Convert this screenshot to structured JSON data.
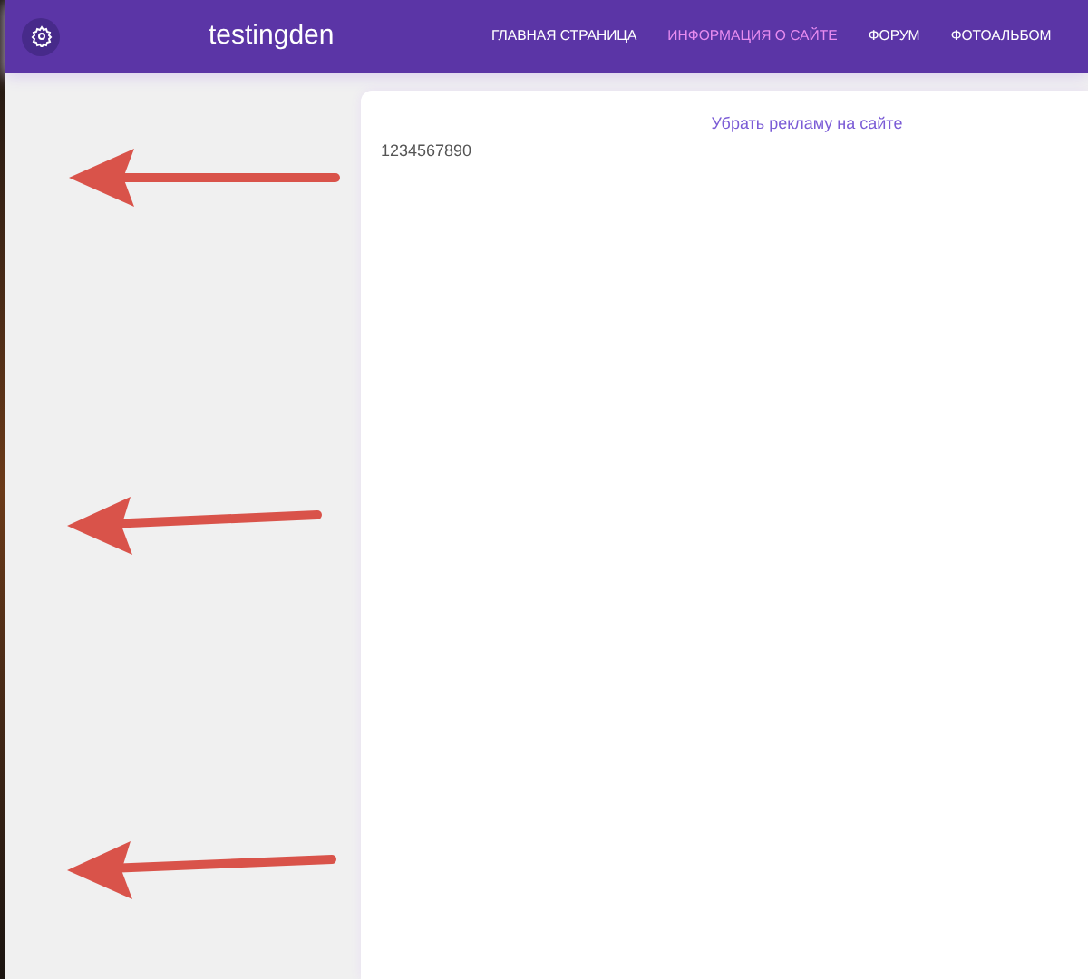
{
  "header": {
    "site_title": "testingden",
    "nav": [
      {
        "label": "ГЛАВНАЯ СТРАНИЦА",
        "selected": false
      },
      {
        "label": "ИНФОРМАЦИЯ О САЙТЕ",
        "selected": true
      },
      {
        "label": "ФОРУМ",
        "selected": false
      },
      {
        "label": "ФОТОАЛЬБОМ",
        "selected": false
      }
    ]
  },
  "content": {
    "ad_link": "Убрать рекламу на сайте",
    "text": "1234567890"
  }
}
